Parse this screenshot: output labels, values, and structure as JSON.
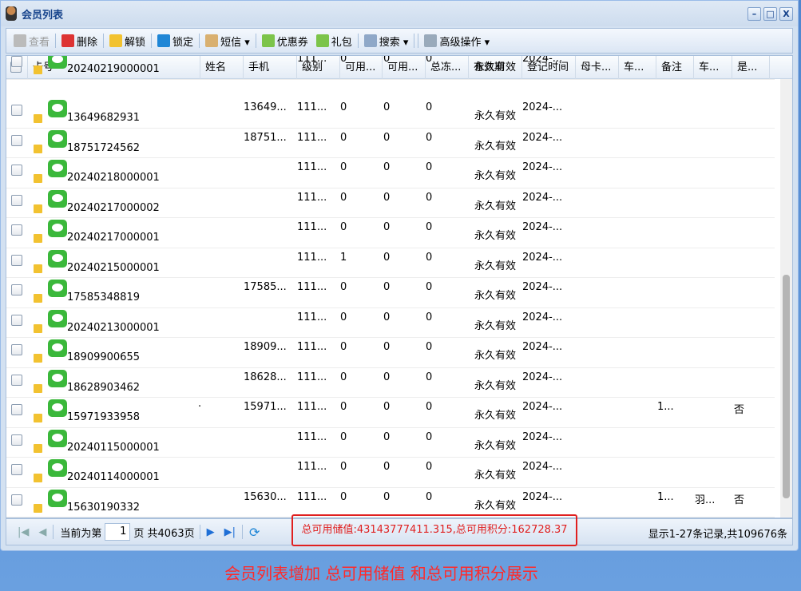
{
  "window": {
    "title": "会员列表",
    "min": "–",
    "max": "□",
    "close": "X"
  },
  "toolbar": [
    {
      "label": "查看",
      "disabled": true,
      "color": "#bbb"
    },
    {
      "label": "删除",
      "color": "#d33"
    },
    {
      "label": "解锁",
      "color": "#f2c230"
    },
    {
      "label": "锁定",
      "color": "#1f86d6"
    },
    {
      "label": "短信 ▾",
      "color": "#d9b070"
    },
    {
      "label": "优惠券",
      "color": "#7cc44a"
    },
    {
      "label": "礼包",
      "color": "#7cc44a"
    },
    {
      "label": "搜索 ▾",
      "color": "#8fa8c8"
    },
    {
      "label": "高级操作 ▾",
      "color": "#9ab"
    }
  ],
  "columns": [
    "卡号",
    "姓名",
    "手机",
    "级别",
    "可用...",
    "可用...",
    "总冻...",
    "有效期",
    "登记时间",
    "母卡...",
    "车...",
    "备注",
    "车...",
    "是..."
  ],
  "rows": [
    {
      "card": "20240219000001",
      "phone": "",
      "level": "111...",
      "a": "0",
      "b": "0",
      "c": "0",
      "valid": "永久有效",
      "reg": "2024-...",
      "note": "",
      "car": "",
      "yn": ""
    },
    {
      "card": "13649682931",
      "phone": "13649...",
      "level": "111...",
      "a": "0",
      "b": "0",
      "c": "0",
      "valid": "永久有效",
      "reg": "2024-...",
      "note": "",
      "car": "",
      "yn": ""
    },
    {
      "card": "18751724562",
      "phone": "18751...",
      "level": "111...",
      "a": "0",
      "b": "0",
      "c": "0",
      "valid": "永久有效",
      "reg": "2024-...",
      "note": "",
      "car": "",
      "yn": ""
    },
    {
      "card": "20240218000001",
      "phone": "",
      "level": "111...",
      "a": "0",
      "b": "0",
      "c": "0",
      "valid": "永久有效",
      "reg": "2024-...",
      "note": "",
      "car": "",
      "yn": ""
    },
    {
      "card": "20240217000002",
      "phone": "",
      "level": "111...",
      "a": "0",
      "b": "0",
      "c": "0",
      "valid": "永久有效",
      "reg": "2024-...",
      "note": "",
      "car": "",
      "yn": ""
    },
    {
      "card": "20240217000001",
      "phone": "",
      "level": "111...",
      "a": "0",
      "b": "0",
      "c": "0",
      "valid": "永久有效",
      "reg": "2024-...",
      "note": "",
      "car": "",
      "yn": ""
    },
    {
      "card": "20240215000001",
      "phone": "",
      "level": "111...",
      "a": "1",
      "b": "0",
      "c": "0",
      "valid": "永久有效",
      "reg": "2024-...",
      "note": "",
      "car": "",
      "yn": ""
    },
    {
      "card": "17585348819",
      "phone": "17585...",
      "level": "111...",
      "a": "0",
      "b": "0",
      "c": "0",
      "valid": "永久有效",
      "reg": "2024-...",
      "note": "",
      "car": "",
      "yn": ""
    },
    {
      "card": "20240213000001",
      "phone": "",
      "level": "111...",
      "a": "0",
      "b": "0",
      "c": "0",
      "valid": "永久有效",
      "reg": "2024-...",
      "note": "",
      "car": "",
      "yn": ""
    },
    {
      "card": "18909900655",
      "phone": "18909...",
      "level": "111...",
      "a": "0",
      "b": "0",
      "c": "0",
      "valid": "永久有效",
      "reg": "2024-...",
      "note": "",
      "car": "",
      "yn": ""
    },
    {
      "card": "18628903462",
      "phone": "18628...",
      "level": "111...",
      "a": "0",
      "b": "0",
      "c": "0",
      "valid": "永久有效",
      "reg": "2024-...",
      "note": "",
      "car": "",
      "yn": ""
    },
    {
      "card": "15971933958",
      "name": "·",
      "phone": "15971...",
      "level": "111...",
      "a": "0",
      "b": "0",
      "c": "0",
      "valid": "永久有效",
      "reg": "2024-...",
      "note": "1...",
      "car": "",
      "yn": "否"
    },
    {
      "card": "20240115000001",
      "phone": "",
      "level": "111...",
      "a": "0",
      "b": "0",
      "c": "0",
      "valid": "永久有效",
      "reg": "2024-...",
      "note": "",
      "car": "",
      "yn": ""
    },
    {
      "card": "20240114000001",
      "phone": "",
      "level": "111...",
      "a": "0",
      "b": "0",
      "c": "0",
      "valid": "永久有效",
      "reg": "2024-...",
      "note": "",
      "car": "",
      "yn": ""
    },
    {
      "card": "15630190332",
      "phone": "15630...",
      "level": "111...",
      "a": "0",
      "b": "0",
      "c": "0",
      "valid": "永久有效",
      "reg": "2024-...",
      "note": "1...",
      "car": "羽...",
      "yn": "否"
    }
  ],
  "pager": {
    "prefix": "当前为第",
    "page": "1",
    "suffix": "页 共4063页",
    "totals": "总可用储值:43143777411.315,总可用积分:162728.37",
    "display": "显示1-27条记录,共109676条"
  },
  "caption": "会员列表增加 总可用储值 和总可用积分展示"
}
